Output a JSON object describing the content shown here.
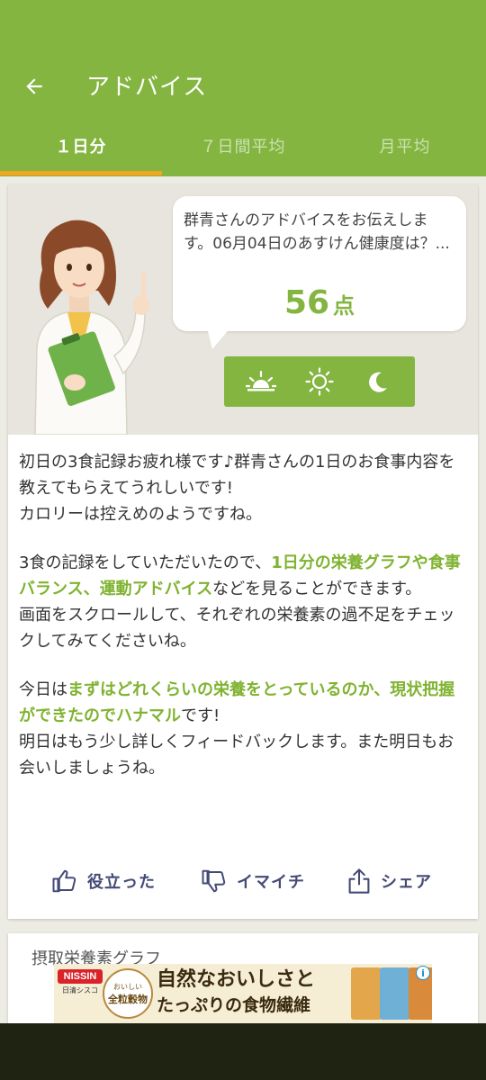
{
  "header": {
    "title": "アドバイス",
    "back_icon": "arrow-left-icon"
  },
  "tabs": [
    {
      "label": "１日分",
      "active": true
    },
    {
      "label": "７日間平均",
      "active": false
    },
    {
      "label": "月平均",
      "active": false
    }
  ],
  "advice": {
    "speech": "群青さんのアドバイスをお伝えします。06月04日のあすけん健康度は？...",
    "score": "56",
    "score_unit": "点",
    "meal_icons": [
      "sunrise-icon",
      "sun-icon",
      "moon-icon"
    ],
    "paragraph1": "初日の3食記録お疲れ様です♪群青さんの1日のお食事内容を教えてもらえてうれしいです!\nカロリーは控えめのようですね。",
    "paragraph2": {
      "before": "3食の記録をしていただいたので、",
      "highlight": "1日分の栄養グラフや食事バランス、運動アドバイス",
      "after": "などを見ることができます。\n画面をスクロールして、それぞれの栄養素の過不足をチェックしてみてくださいね。"
    },
    "paragraph3": {
      "before": "今日は",
      "highlight1": "まずはどれくらいの栄養をとっているのか、現状把握ができたのでハナマル",
      "after": "です!\n明日はもう少し詳しくフィードバックします。また明日もお会いしましょうね。"
    }
  },
  "actions": {
    "helpful": "役立った",
    "not_helpful": "イマイチ",
    "share": "シェア"
  },
  "next_section": {
    "title": "摂取栄養素グラフ"
  },
  "ad": {
    "brand": "NISSIN",
    "brand_sub": "日清シスコ",
    "badge_top": "おいしい",
    "badge_main": "全粒穀物",
    "line1": "自然なおいしさと",
    "line2": "たっぷりの食物繊維",
    "info_icon": "info-icon"
  },
  "colors": {
    "brand_green": "#83b540",
    "tab_indicator": "#f3a51f",
    "action_text": "#444a76",
    "highlight_text": "#7fb330"
  }
}
